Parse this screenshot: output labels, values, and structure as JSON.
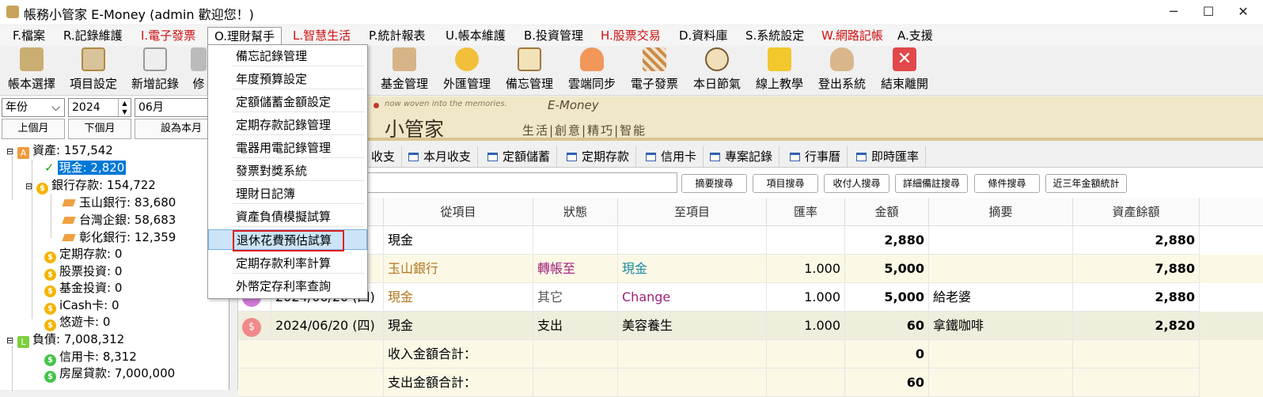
{
  "window": {
    "title": "帳務小管家 E-Money (admin 歡迎您！)",
    "controls": [
      "─",
      "☐",
      "✕"
    ]
  },
  "menubar": [
    {
      "label": "F.檔案",
      "color": "normal"
    },
    {
      "label": "R.記錄維護",
      "color": "normal"
    },
    {
      "label": "I.電子發票",
      "color": "red"
    },
    {
      "label": "O.理財幫手",
      "color": "normal"
    },
    {
      "label": "L.智慧生活",
      "color": "red"
    },
    {
      "label": "P.統計報表",
      "color": "normal"
    },
    {
      "label": "U.帳本維護",
      "color": "normal"
    },
    {
      "label": "B.投資管理",
      "color": "normal"
    },
    {
      "label": "H.股票交易",
      "color": "red"
    },
    {
      "label": "D.資料庫",
      "color": "normal"
    },
    {
      "label": "S.系統設定",
      "color": "normal"
    },
    {
      "label": "W.網路記帳",
      "color": "red"
    },
    {
      "label": "A.支援",
      "color": "normal"
    }
  ],
  "toolbar": [
    {
      "label": "帳本選擇",
      "icon": "ledger-icon"
    },
    {
      "label": "項目設定",
      "icon": "settings-icon"
    },
    {
      "label": "新增記錄",
      "icon": "add-record-icon"
    },
    {
      "label": "修",
      "icon": "edit-icon"
    },
    {
      "label": "基金管理",
      "icon": "fund-icon"
    },
    {
      "label": "外匯管理",
      "icon": "forex-icon"
    },
    {
      "label": "備忘管理",
      "icon": "memo-icon"
    },
    {
      "label": "雲端同步",
      "icon": "cloud-sync-icon"
    },
    {
      "label": "電子發票",
      "icon": "qr-invoice-icon"
    },
    {
      "label": "本日節氣",
      "icon": "solar-term-icon"
    },
    {
      "label": "線上教學",
      "icon": "help-icon"
    },
    {
      "label": "登出系統",
      "icon": "logout-icon"
    },
    {
      "label": "結束離開",
      "icon": "exit-icon"
    }
  ],
  "filter": {
    "period_type": "年份",
    "year": "2024",
    "month": "06月",
    "prev_month": "上個月",
    "next_month": "下個月",
    "set_current": "設為本月"
  },
  "tree": [
    {
      "label": "資產: 157,542",
      "icon": "A",
      "level": 0
    },
    {
      "label": "現金: 2,820",
      "icon": "check",
      "level": 1,
      "selected": true
    },
    {
      "label": "銀行存款: 154,722",
      "icon": "coin",
      "level": 1
    },
    {
      "label": "玉山銀行: 83,680",
      "icon": "tag",
      "level": 2
    },
    {
      "label": "台灣企銀: 58,683",
      "icon": "tag",
      "level": 2
    },
    {
      "label": "彰化銀行: 12,359",
      "icon": "tag",
      "level": 2
    },
    {
      "label": "定期存款: 0",
      "icon": "coin",
      "level": 1
    },
    {
      "label": "股票投資: 0",
      "icon": "coin",
      "level": 1
    },
    {
      "label": "基金投資: 0",
      "icon": "coin",
      "level": 1
    },
    {
      "label": "iCash卡: 0",
      "icon": "coin",
      "level": 1
    },
    {
      "label": "悠遊卡: 0",
      "icon": "coin",
      "level": 1
    },
    {
      "label": "負債: 7,008,312",
      "icon": "L",
      "level": 0
    },
    {
      "label": "信用卡: 8,312",
      "icon": "gcoin",
      "level": 1
    },
    {
      "label": "房屋貸款: 7,000,000",
      "icon": "gcoin",
      "level": 1
    }
  ],
  "banner": {
    "tagline": "now woven into the memories.",
    "brand": "E-Money",
    "name": "小管家",
    "motto": "生活|創意|精巧|智能"
  },
  "tabs": [
    "收支",
    "本月收支",
    "定額儲蓄",
    "定期存款",
    "信用卡",
    "專案記錄",
    "行事曆",
    "即時匯率"
  ],
  "search_buttons": [
    "摘要搜尋",
    "項目搜尋",
    "收付人搜尋",
    "詳細備註搜尋",
    "條件搜尋",
    "近三年金額統計"
  ],
  "grid": {
    "headers": [
      "從項目",
      "狀態",
      "至項目",
      "匯率",
      "金額",
      "摘要",
      "資產餘額"
    ],
    "rows": [
      {
        "date": "",
        "from": "現金",
        "status": "",
        "to": "",
        "rate": "",
        "amount": "2,880",
        "memo": "",
        "balance": "2,880"
      },
      {
        "date": "",
        "from": "玉山銀行",
        "status": "轉帳至",
        "to": "現金",
        "rate": "1.000",
        "amount": "5,000",
        "memo": "",
        "balance": "7,880"
      },
      {
        "date": "2024/06/20 (四)",
        "from": "現金",
        "status": "其它",
        "to": "Change",
        "rate": "1.000",
        "amount": "5,000",
        "memo": "給老婆",
        "balance": "2,880"
      },
      {
        "date": "2024/06/20 (四)",
        "from": "現金",
        "status": "支出",
        "to": "美容養生",
        "rate": "1.000",
        "amount": "60",
        "memo": "拿鐵咖啡",
        "balance": "2,820"
      },
      {
        "date": "",
        "from": "收入金額合計：",
        "status": "",
        "to": "",
        "rate": "",
        "amount": "0",
        "memo": "",
        "balance": ""
      },
      {
        "date": "",
        "from": "支出金額合計：",
        "status": "",
        "to": "",
        "rate": "",
        "amount": "60",
        "memo": "",
        "balance": ""
      }
    ]
  },
  "dropdown": {
    "items": [
      "備忘記錄管理",
      "年度預算設定",
      "定額儲蓄金額設定",
      "定期存款記錄管理",
      "電器用電記錄管理",
      "發票對獎系統",
      "理財日記簿",
      "資產負債模擬試算",
      "退休花費預估試算",
      "定期存款利率計算",
      "外幣定存利率查詢"
    ],
    "selected_index": 8
  },
  "colors": {
    "red_menu": "#d01010",
    "from_brown": "#b07820",
    "status_purple": "#a0207a",
    "to_teal": "#1a8aa0",
    "selection": "#0078d7",
    "banner_bg": "#efe7c8"
  }
}
